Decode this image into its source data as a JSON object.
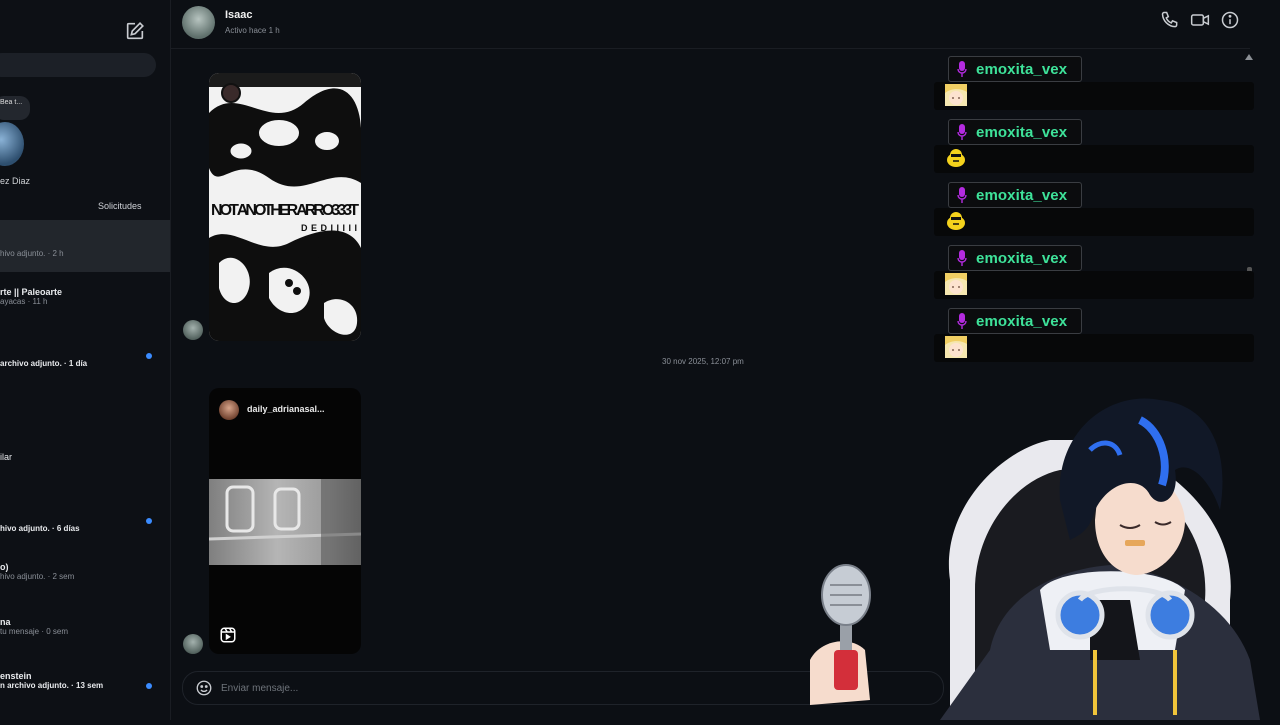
{
  "sidebar": {
    "story_name": "ez Diaz",
    "story_bubble": "Bea t...",
    "requests_label": "Solicitudes",
    "conversations": [
      {
        "name": "",
        "preview": "hivo adjunto. · 2 h",
        "bold": false,
        "unread": false
      },
      {
        "name": "rte || Paleoarte",
        "preview": "ayacas · 11 h",
        "bold": false,
        "unread": false
      },
      {
        "name": "",
        "preview": "archivo adjunto. · 1 día",
        "bold": true,
        "unread": true
      },
      {
        "name": "ilar",
        "preview": "",
        "bold": false,
        "unread": false
      },
      {
        "name": "",
        "preview": "hivo adjunto. · 6 días",
        "bold": true,
        "unread": true
      },
      {
        "name": "o)",
        "preview": "hivo adjunto. · 2 sem",
        "bold": false,
        "unread": false
      },
      {
        "name": "na",
        "preview": "tu mensaje · 0 sem",
        "bold": false,
        "unread": false
      },
      {
        "name": "enstein",
        "preview": "n archivo adjunto. · 13 sem",
        "bold": true,
        "unread": true
      }
    ]
  },
  "header": {
    "name": "Isaac",
    "status": "Activo hace 1 h",
    "icons": [
      "phone-icon",
      "video-camera-icon",
      "info-icon"
    ]
  },
  "messages": {
    "card1_banner": "NOT ANOTHER ARRO333T",
    "card1_sub": "DEDIIIII",
    "timestamp": "30 nov 2025, 12:07 pm",
    "card2_user": "daily_adrianasal..."
  },
  "composer": {
    "placeholder": "Enviar mensaje..."
  },
  "stream_chat": [
    {
      "user": "emoxita_vex",
      "emote": "blonde-face-emote"
    },
    {
      "user": "emoxita_vex",
      "emote": "yellow-duck-emote"
    },
    {
      "user": "emoxita_vex",
      "emote": "yellow-duck-emote"
    },
    {
      "user": "emoxita_vex",
      "emote": "blonde-face-emote"
    },
    {
      "user": "emoxita_vex",
      "emote": "blonde-face-emote"
    }
  ],
  "colors": {
    "background": "#0c0f14",
    "username": "#3ee39a",
    "mic_badge": "#b42be0",
    "unread_dot": "#3b8cff"
  }
}
